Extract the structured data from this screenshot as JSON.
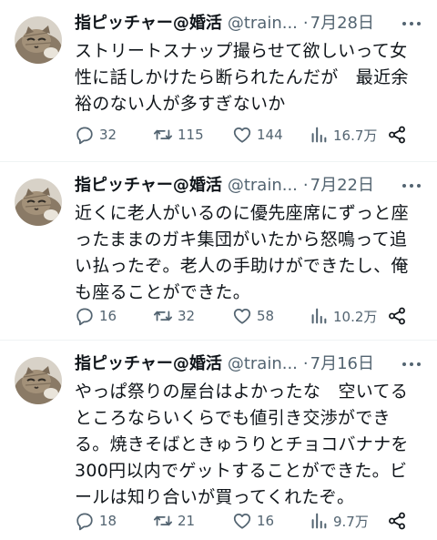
{
  "tweets": [
    {
      "name": "指ピッチャー@婚活",
      "handle": "@train...",
      "date": "7月28日",
      "text": "ストリートスナップ撮らせて欲しいって女\n性に話しかけたら断られたんだが　最近余\n裕のない人が多すぎないか",
      "replies": "32",
      "retweets": "115",
      "likes": "144",
      "views": "16.7万"
    },
    {
      "name": "指ピッチャー@婚活",
      "handle": "@train...",
      "date": "7月22日",
      "text": "近くに老人がいるのに優先座席にずっと座\nったままのガキ集団がいたから怒鳴って追\nい払ったぞ。老人の手助けができたし、俺\nも座ることができた。",
      "replies": "16",
      "retweets": "32",
      "likes": "58",
      "views": "10.2万"
    },
    {
      "name": "指ピッチャー@婚活",
      "handle": "@train...",
      "date": "7月16日",
      "text": "やっぱ祭りの屋台はよかったな　空いてる\nところならいくらでも値引き交渉ができ\nる。焼きそばときゅうりとチョコバナナを\n300円以内でゲットすることができた。ビ\nールは知り合いが買ってくれたぞ。",
      "replies": "18",
      "retweets": "21",
      "likes": "16",
      "views": "9.7万"
    }
  ],
  "icons": {
    "reply": "reply-icon",
    "retweet": "retweet-icon",
    "like": "heart-icon",
    "views": "views-icon",
    "share": "share-icon",
    "more": "more-icon"
  },
  "colors": {
    "text": "#0f1419",
    "secondary": "#536471",
    "divider": "#eff3f4"
  }
}
